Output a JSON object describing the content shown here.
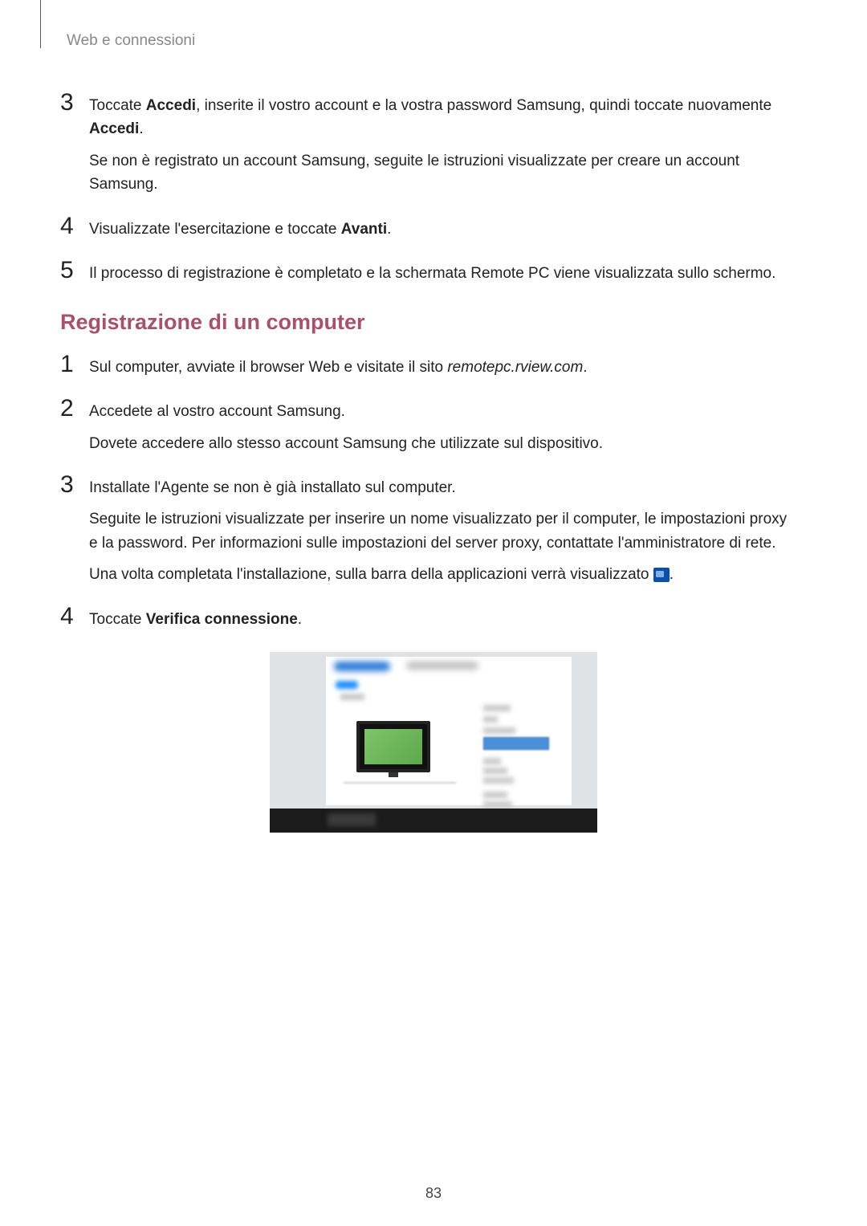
{
  "breadcrumb": "Web e connessioni",
  "steps_a": [
    {
      "num": "3",
      "lines": [
        "Toccate <b>Accedi</b>, inserite il vostro account e la vostra password Samsung, quindi toccate nuovamente <b>Accedi</b>.",
        "Se non è registrato un account Samsung, seguite le istruzioni visualizzate per creare un account Samsung."
      ]
    },
    {
      "num": "4",
      "lines": [
        "Visualizzate l'esercitazione e toccate <b>Avanti</b>."
      ]
    },
    {
      "num": "5",
      "lines": [
        "Il processo di registrazione è completato e la schermata Remote PC viene visualizzata sullo schermo."
      ]
    }
  ],
  "section_title": "Registrazione di un computer",
  "steps_b": [
    {
      "num": "1",
      "lines": [
        "Sul computer, avviate il browser Web e visitate il sito <i>remotepc.rview.com</i>."
      ]
    },
    {
      "num": "2",
      "lines": [
        "Accedete al vostro account Samsung.",
        "Dovete accedere allo stesso account Samsung che utilizzate sul dispositivo."
      ]
    },
    {
      "num": "3",
      "lines": [
        "Installate l'Agente se non è già installato sul computer.",
        "Seguite le istruzioni visualizzate per inserire un nome visualizzato per il computer, le impostazioni proxy e la password. Per informazioni sulle impostazioni del server proxy, contattate l'amministratore di rete.",
        "Una volta completata l'installazione, sulla barra della applicazioni verrà visualizzato [ICON]."
      ]
    },
    {
      "num": "4",
      "lines": [
        "Toccate <b>Verifica connessione</b>."
      ]
    }
  ],
  "page_number": "83"
}
